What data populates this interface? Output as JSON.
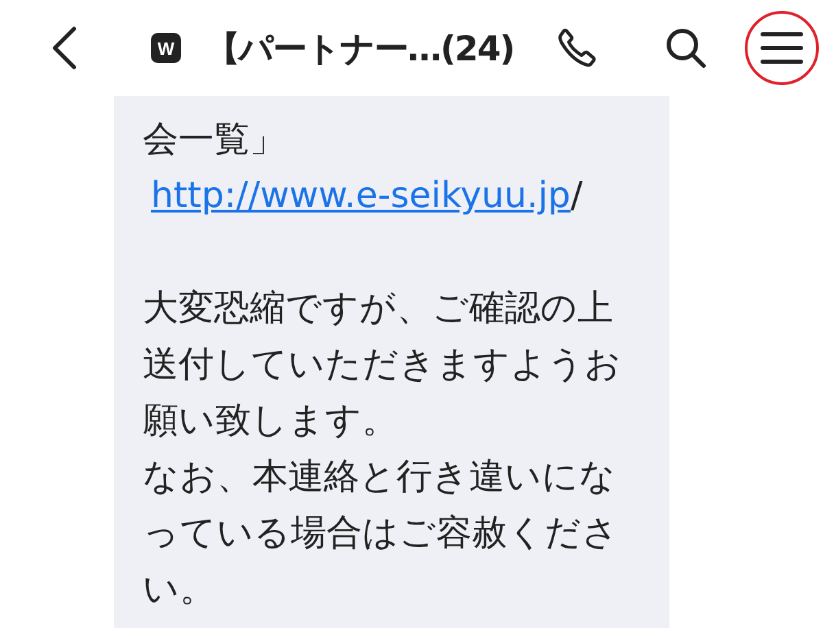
{
  "header": {
    "logo": "W",
    "title": "【パートナー…(24)",
    "menu_highlighted": true
  },
  "message": {
    "lines": [
      {
        "kind": "text",
        "text": "会一覧」"
      },
      {
        "kind": "link",
        "text": "http://www.e-seikyuu.jp",
        "after": "/"
      },
      {
        "kind": "blank"
      },
      {
        "kind": "text",
        "text": "大変恐縮ですが、ご確認の上"
      },
      {
        "kind": "text",
        "text": "送付していただきますようお"
      },
      {
        "kind": "text",
        "text": "願い致します。"
      },
      {
        "kind": "text",
        "text": "なお、本連絡と行き違いにな"
      },
      {
        "kind": "text",
        "text": "っている場合はご容赦くださ"
      },
      {
        "kind": "text",
        "text": "い。"
      }
    ]
  }
}
